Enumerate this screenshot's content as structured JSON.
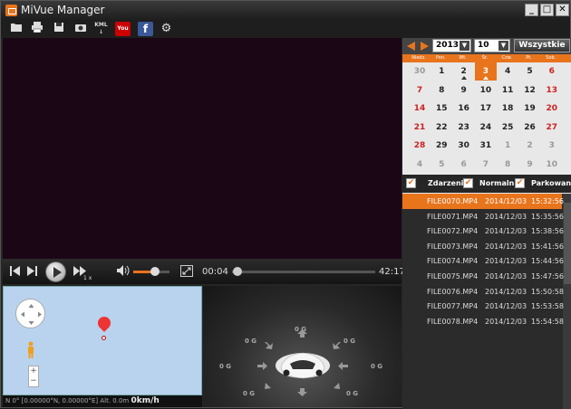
{
  "window": {
    "title": "MiVue Manager",
    "minimize": "_",
    "maximize": "□",
    "close": "✕"
  },
  "toolbar": [
    {
      "name": "open-folder-icon",
      "glyph": "▰"
    },
    {
      "name": "print-icon",
      "glyph": "⎙"
    },
    {
      "name": "save-icon",
      "glyph": "▪"
    },
    {
      "name": "snapshot-camera-icon",
      "glyph": "◙"
    },
    {
      "name": "kml-export-icon",
      "glyph": "KML"
    },
    {
      "name": "youtube-icon",
      "glyph": "You"
    },
    {
      "name": "facebook-icon",
      "glyph": "f"
    },
    {
      "name": "settings-gear-icon",
      "glyph": "⚙"
    }
  ],
  "player": {
    "speed": "1 x",
    "current_time": "00:04",
    "total_time": "42:17",
    "progress": 0.02,
    "volume": 0.6
  },
  "gps": {
    "coords": "N 0° [0.00000°N, 0.00000°E]",
    "altitude": "Alt. 0.0m",
    "speed": "0km/h"
  },
  "gsensor": {
    "labels": [
      "0 G",
      "0 G",
      "0 G",
      "0 G",
      "0 G",
      "0 G",
      "0 G"
    ]
  },
  "calendar": {
    "year": "2013",
    "month": "10",
    "all_label": "Wszystkie",
    "weekdays": [
      "Niedz.",
      "Pon.",
      "Wt.",
      "Śr.",
      "Czw.",
      "Pt.",
      "Sob."
    ],
    "weeks": [
      [
        "30",
        "1",
        "2",
        "3",
        "4",
        "5",
        "6"
      ],
      [
        "7",
        "8",
        "9",
        "10",
        "11",
        "12",
        "13"
      ],
      [
        "14",
        "15",
        "16",
        "17",
        "18",
        "19",
        "20"
      ],
      [
        "21",
        "22",
        "23",
        "24",
        "25",
        "26",
        "27"
      ],
      [
        "28",
        "29",
        "30",
        "31",
        "1",
        "2",
        "3"
      ],
      [
        "4",
        "5",
        "6",
        "7",
        "8",
        "9",
        "10"
      ]
    ]
  },
  "filters": [
    "Zdarzeni",
    "Normaln",
    "Parkowanie"
  ],
  "files": [
    {
      "name": "FILE0070.MP4",
      "date": "2014/12/03",
      "time": "15:32:56"
    },
    {
      "name": "FILE0071.MP4",
      "date": "2014/12/03",
      "time": "15:35:56"
    },
    {
      "name": "FILE0072.MP4",
      "date": "2014/12/03",
      "time": "15:38:56"
    },
    {
      "name": "FILE0073.MP4",
      "date": "2014/12/03",
      "time": "15:41:56"
    },
    {
      "name": "FILE0074.MP4",
      "date": "2014/12/03",
      "time": "15:44:56"
    },
    {
      "name": "FILE0075.MP4",
      "date": "2014/12/03",
      "time": "15:47:56"
    },
    {
      "name": "FILE0076.MP4",
      "date": "2014/12/03",
      "time": "15:50:58"
    },
    {
      "name": "FILE0077.MP4",
      "date": "2014/12/03",
      "time": "15:53:58"
    },
    {
      "name": "FILE0078.MP4",
      "date": "2014/12/03",
      "time": "15:54:58"
    }
  ],
  "colors": {
    "accent": "#e8741c",
    "weekend": "#d02020",
    "video_bg": "#1b0616"
  }
}
